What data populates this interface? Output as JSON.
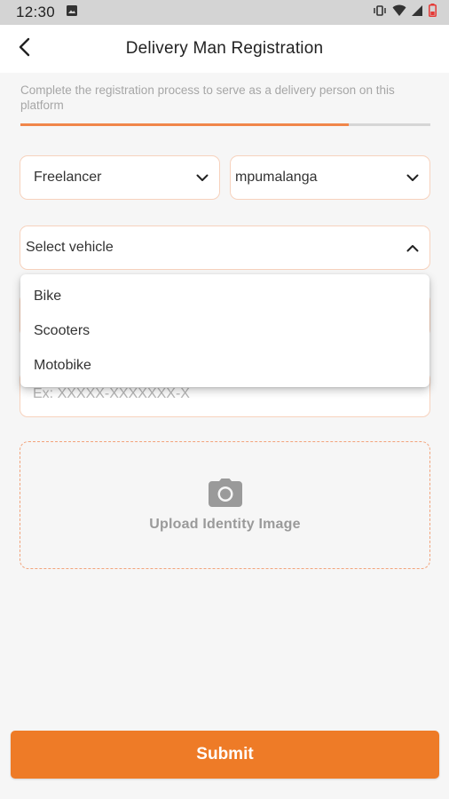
{
  "status_bar": {
    "time": "12:30",
    "icons": [
      "image-icon",
      "vibrate-icon",
      "wifi-icon",
      "signal-icon",
      "battery-icon"
    ]
  },
  "header": {
    "title": "Delivery Man Registration",
    "back_icon": "back-arrow-icon"
  },
  "subtitle": "Complete the registration process to serve as a delivery person on this platform",
  "progress": {
    "value_fraction": 0.8
  },
  "form": {
    "employment_type": {
      "value": "Freelancer",
      "icon": "chevron-down-icon"
    },
    "zone": {
      "value": "mpumalanga",
      "icon": "chevron-down-icon"
    },
    "vehicle": {
      "value": "Select vehicle",
      "icon": "chevron-up-icon",
      "options": [
        "Bike",
        "Scooters",
        "Motobike"
      ]
    },
    "identity_number": {
      "value": "",
      "placeholder": "Ex: XXXXX-XXXXXXX-X"
    },
    "upload": {
      "label": "Upload Identity Image",
      "icon": "camera-icon"
    },
    "submit_label": "Submit"
  },
  "colors": {
    "accent": "#ee7b27",
    "progress": "#f0864a",
    "field_border": "#f7d2bd",
    "dashed_border": "#f2a37b"
  }
}
